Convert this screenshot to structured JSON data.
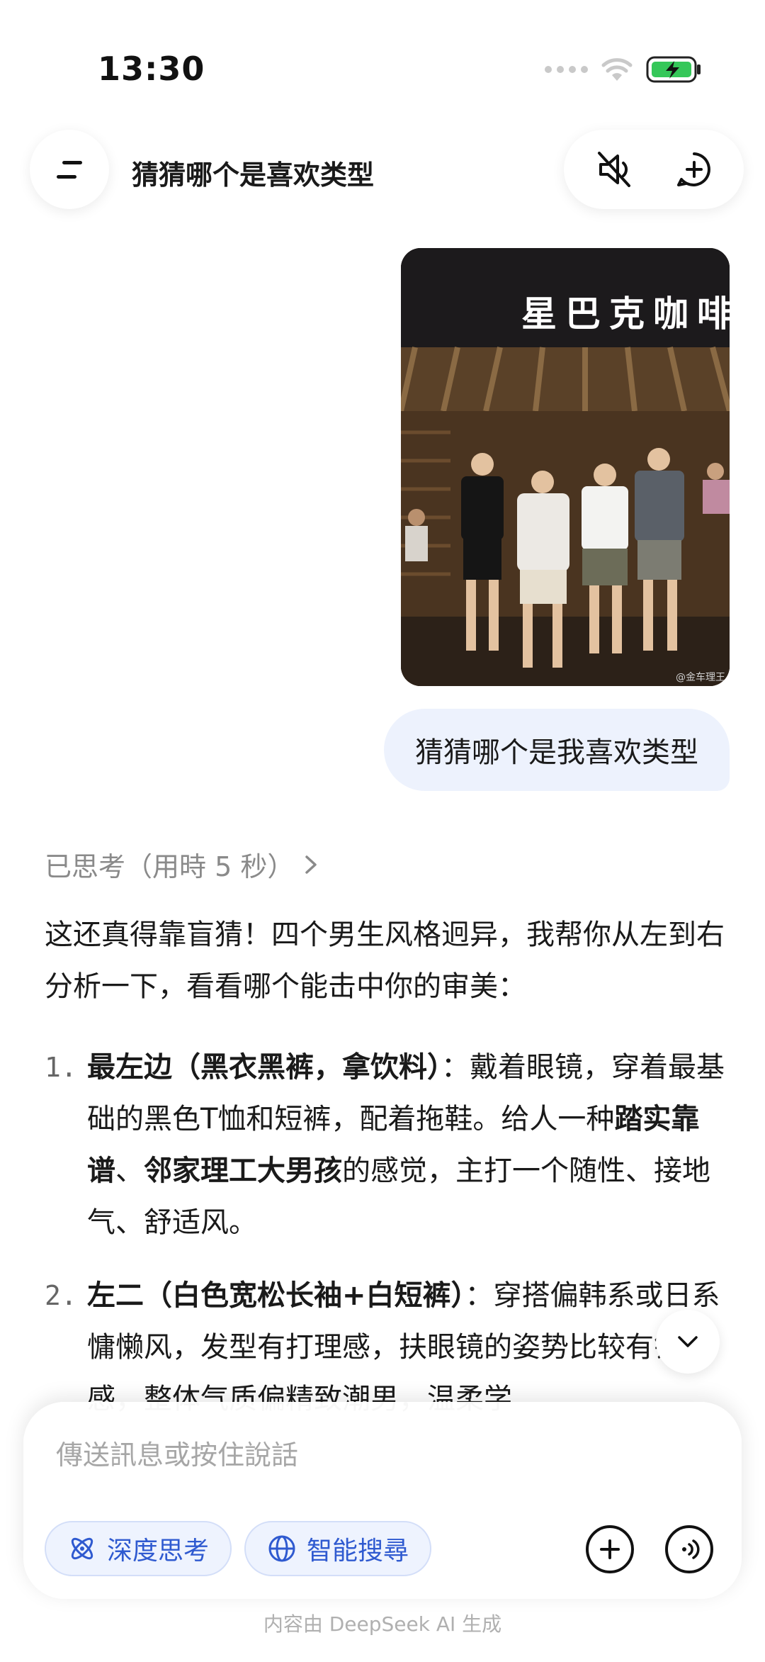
{
  "status_bar": {
    "time": "13:30"
  },
  "header": {
    "title": "猜猜哪个是喜欢类型"
  },
  "photo": {
    "sign_text": "星巴克咖啡",
    "watermark": "@金车理王"
  },
  "user_message": "猜猜哪个是我喜欢类型",
  "thinking": {
    "label": "已思考（用時 5 秒）"
  },
  "answer": {
    "intro": "这还真得靠盲猜！四个男生风格迥异，我帮你从左到右分析一下，看看哪个能击中你的审美：",
    "items": [
      {
        "num": "1.",
        "title": "最左边（黑衣黑裤，拿饮料）",
        "t1": "：戴着眼镜，穿着最基础的黑色T恤和短裤，配着拖鞋。给人一种",
        "b1": "踏实靠谱",
        "t2": "、",
        "b2": "邻家理工大男孩",
        "t3": "的感觉，主打一个随性、接地气、舒适风。"
      },
      {
        "num": "2.",
        "title": "左二（白色宽松长袖+白短裤）",
        "t1": "：穿搭偏韩系或日系慵懒风，发型有打理感，扶眼镜的姿势比较有镜头感，整体气质偏精致潮男，温柔学"
      }
    ]
  },
  "composer": {
    "placeholder": "傳送訊息或按住說話",
    "deep_think_label": "深度思考",
    "search_label": "智能搜尋"
  },
  "footer": {
    "note": "内容由 DeepSeek AI 生成"
  },
  "colors": {
    "accent": "#2f5ad0",
    "bubble": "#edf2fd",
    "battery": "#35c759"
  }
}
